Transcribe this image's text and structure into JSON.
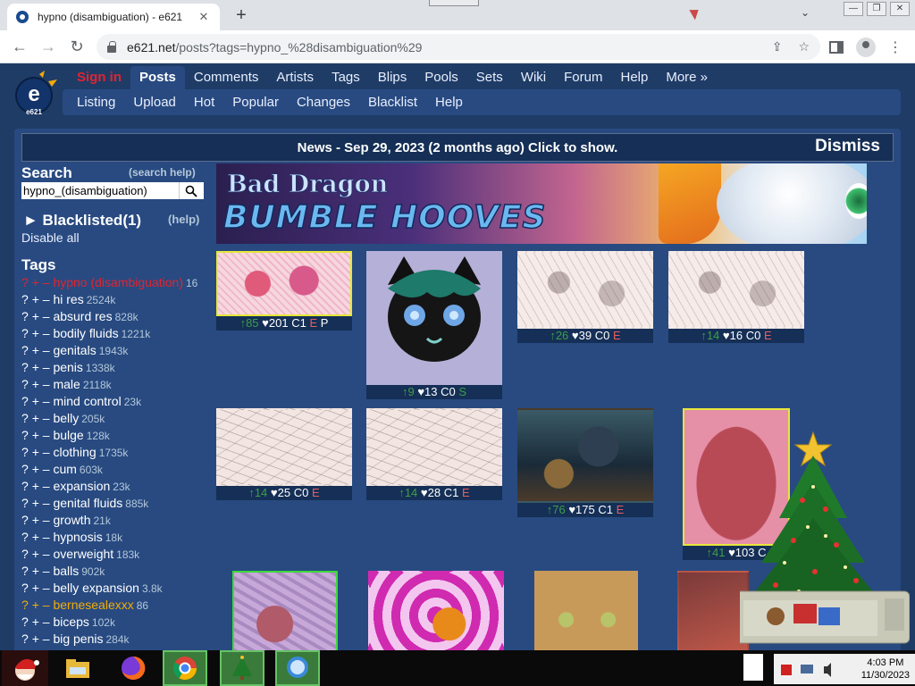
{
  "browser": {
    "tab_title": "hypno (disambiguation) - e621",
    "tab_close": "✕",
    "new_tab": "+",
    "tab_chevron": "⌄",
    "window_controls": [
      "—",
      "❐",
      "✕"
    ],
    "url_host": "e621.net",
    "url_path": "/posts?tags=hypno_%28disambiguation%29",
    "nav_icons": [
      "back-icon",
      "forward-icon",
      "reload-icon"
    ],
    "toolbar_icons": [
      "share-icon",
      "star-icon",
      "side-panel-icon",
      "profile-icon",
      "menu-icon"
    ]
  },
  "site": {
    "nav_main": [
      {
        "label": "Sign in",
        "style": "signin"
      },
      {
        "label": "Posts",
        "style": "active"
      },
      {
        "label": "Comments",
        "style": ""
      },
      {
        "label": "Artists",
        "style": ""
      },
      {
        "label": "Tags",
        "style": ""
      },
      {
        "label": "Blips",
        "style": ""
      },
      {
        "label": "Pools",
        "style": ""
      },
      {
        "label": "Sets",
        "style": ""
      },
      {
        "label": "Wiki",
        "style": ""
      },
      {
        "label": "Forum",
        "style": ""
      },
      {
        "label": "Help",
        "style": ""
      },
      {
        "label": "More »",
        "style": ""
      }
    ],
    "nav_sub": [
      "Listing",
      "Upload",
      "Hot",
      "Popular",
      "Changes",
      "Blacklist",
      "Help"
    ],
    "logo_text": "e621",
    "news": {
      "text": "News - Sep 29, 2023 (2 months ago) Click to show.",
      "dismiss": "Dismiss"
    },
    "search": {
      "heading": "Search",
      "help": "(search help)",
      "value": "hypno_(disambiguation)"
    },
    "blacklist": {
      "heading": "► Blacklisted(1)",
      "help": "(help)",
      "disable": "Disable all"
    },
    "tags_heading": "Tags",
    "tags": [
      {
        "name": "hypno (disambiguation)",
        "count": "16",
        "type": "hl"
      },
      {
        "name": "hi res",
        "count": "2524k",
        "type": ""
      },
      {
        "name": "absurd res",
        "count": "828k",
        "type": ""
      },
      {
        "name": "bodily fluids",
        "count": "1221k",
        "type": ""
      },
      {
        "name": "genitals",
        "count": "1943k",
        "type": ""
      },
      {
        "name": "penis",
        "count": "1338k",
        "type": ""
      },
      {
        "name": "male",
        "count": "2118k",
        "type": ""
      },
      {
        "name": "mind control",
        "count": "23k",
        "type": ""
      },
      {
        "name": "belly",
        "count": "205k",
        "type": ""
      },
      {
        "name": "bulge",
        "count": "128k",
        "type": ""
      },
      {
        "name": "clothing",
        "count": "1735k",
        "type": ""
      },
      {
        "name": "cum",
        "count": "603k",
        "type": ""
      },
      {
        "name": "expansion",
        "count": "23k",
        "type": ""
      },
      {
        "name": "genital fluids",
        "count": "885k",
        "type": ""
      },
      {
        "name": "growth",
        "count": "21k",
        "type": ""
      },
      {
        "name": "hypnosis",
        "count": "18k",
        "type": ""
      },
      {
        "name": "overweight",
        "count": "183k",
        "type": ""
      },
      {
        "name": "balls",
        "count": "902k",
        "type": ""
      },
      {
        "name": "belly expansion",
        "count": "3.8k",
        "type": ""
      },
      {
        "name": "bernesealexxx",
        "count": "86",
        "type": "artist"
      },
      {
        "name": "biceps",
        "count": "102k",
        "type": ""
      },
      {
        "name": "big penis",
        "count": "284k",
        "type": ""
      }
    ],
    "banner": {
      "line1": "Bad Dragon",
      "line2": "BUMBLE HOOVES"
    },
    "posts": [
      {
        "score": "↑85",
        "favs": "♥201",
        "comments": "C1",
        "ratings": [
          "E",
          "P"
        ]
      },
      {
        "score": "↑9",
        "favs": "♥13",
        "comments": "C0",
        "ratings": [
          "S"
        ]
      },
      {
        "score": "↑26",
        "favs": "♥39",
        "comments": "C0",
        "ratings": [
          "E"
        ]
      },
      {
        "score": "↑14",
        "favs": "♥16",
        "comments": "C0",
        "ratings": [
          "E"
        ]
      },
      {
        "score": "↑14",
        "favs": "♥25",
        "comments": "C0",
        "ratings": [
          "E"
        ]
      },
      {
        "score": "↑14",
        "favs": "♥28",
        "comments": "C1",
        "ratings": [
          "E"
        ]
      },
      {
        "score": "↑76",
        "favs": "♥175",
        "comments": "C1",
        "ratings": [
          "E"
        ]
      },
      {
        "score": "↑41",
        "favs": "♥103",
        "comments": "C",
        "ratings": []
      }
    ]
  },
  "taskbar": {
    "time": "4:03 PM",
    "date": "11/30/2023",
    "apps": [
      "santa-icon",
      "file-explorer-icon",
      "firefox-icon",
      "chrome-icon",
      "tree-icon",
      "chat-icon"
    ]
  },
  "colors": {
    "page_bg": "#1f3c67",
    "panel_bg": "#284a81",
    "signin": "#e0242f",
    "artist": "#f2ac08",
    "score_up": "#3e9e49",
    "rating_e": "#e45f5f"
  }
}
